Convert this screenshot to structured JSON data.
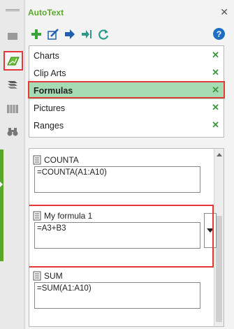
{
  "panel": {
    "title": "AutoText"
  },
  "rail": {
    "items": [
      {
        "icon": "empty-icon"
      },
      {
        "icon": "autotext-icon",
        "selected": true
      },
      {
        "icon": "layers-icon"
      },
      {
        "icon": "columns-icon"
      },
      {
        "icon": "binoculars-icon"
      }
    ]
  },
  "toolbar": {
    "buttons": [
      "add-icon",
      "edit-icon",
      "export-icon",
      "import-icon",
      "refresh-icon"
    ],
    "help_label": "?"
  },
  "categories": {
    "items": [
      {
        "label": "Charts",
        "remove": "✕"
      },
      {
        "label": "Clip Arts",
        "remove": "✕"
      },
      {
        "label": "Formulas",
        "remove": "✕",
        "selected": true
      },
      {
        "label": "Pictures",
        "remove": "✕"
      },
      {
        "label": "Ranges",
        "remove": "✕"
      }
    ]
  },
  "entries": {
    "items": [
      {
        "name": "COUNTA",
        "content": "=COUNTA(A1:A10)"
      },
      {
        "name": "My formula 1",
        "content": "=A3+B3",
        "selected": true
      },
      {
        "name": "SUM",
        "content": "=SUM(A1:A10)"
      }
    ]
  },
  "colors": {
    "accent": "#5aa82e",
    "selection": "#a5dcb4",
    "highlight_border": "#e23a3a",
    "help": "#1e6fc4"
  }
}
